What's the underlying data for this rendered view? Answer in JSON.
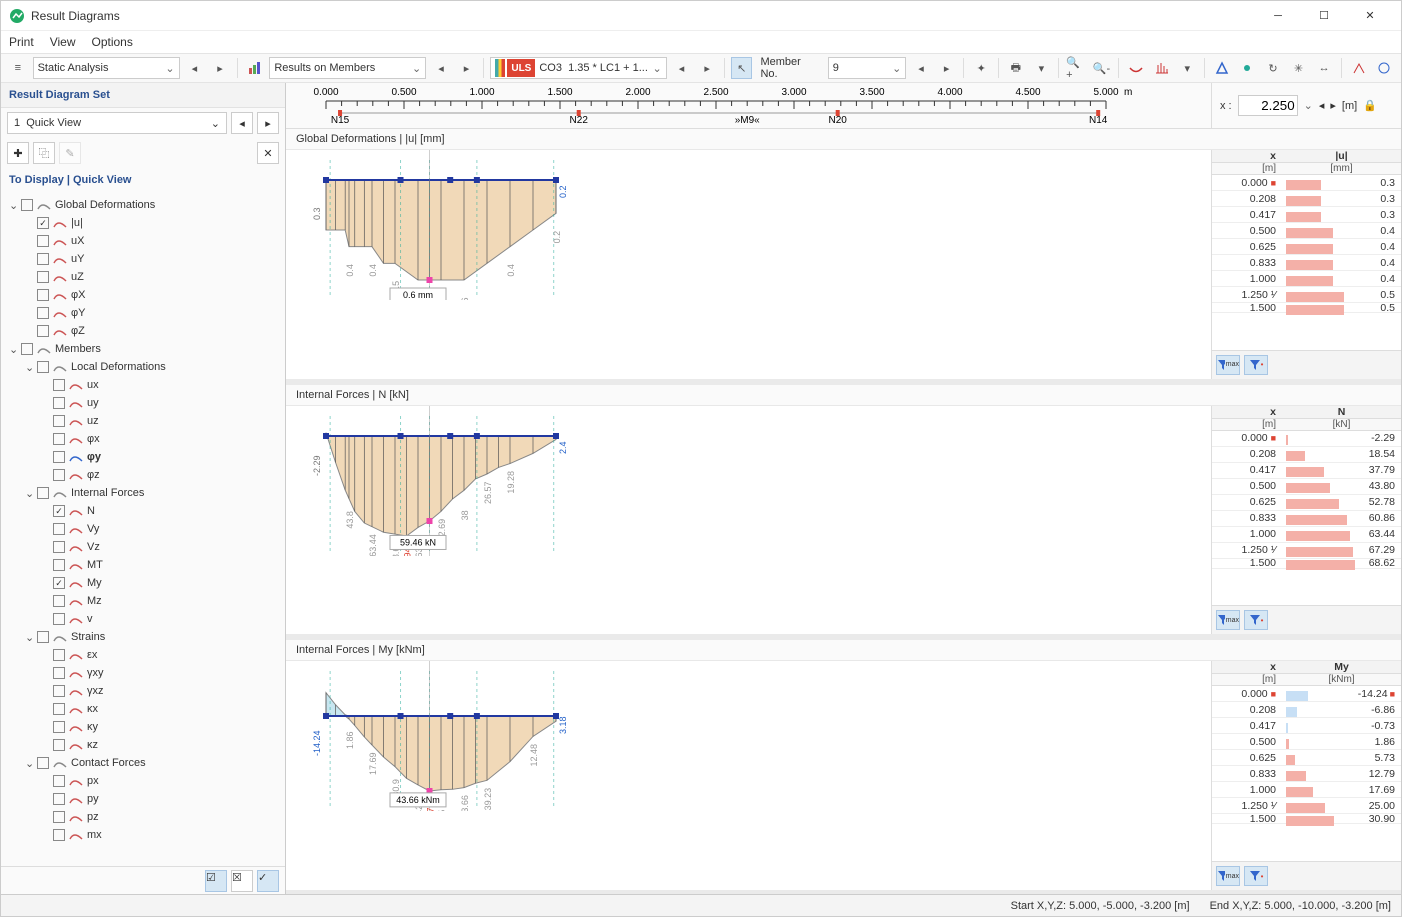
{
  "window": {
    "title": "Result Diagrams"
  },
  "menu": {
    "print": "Print",
    "view": "View",
    "options": "Options"
  },
  "toolbar": {
    "analysis_type": "Static Analysis",
    "results_target": "Results on Members",
    "uls_badge": "ULS",
    "load_combo_id": "CO3",
    "load_combo_expr": "1.35 * LC1 + 1...",
    "member_label": "Member No.",
    "member_no": "9"
  },
  "sidebar": {
    "panel_title": "Result Diagram Set",
    "set_no": "1",
    "set_name": "Quick View",
    "tree_title": "To Display | Quick View",
    "nodes": {
      "global_def": "Global Deformations",
      "u": "|u|",
      "ux": "uX",
      "uy": "uY",
      "uz": "uZ",
      "phix": "φX",
      "phiy": "φY",
      "phiz": "φZ",
      "members": "Members",
      "local_def": "Local Deformations",
      "lux": "ux",
      "luy": "uy",
      "luz": "uz",
      "lphix": "φx",
      "lphiy": "φy",
      "lphiz": "φz",
      "internal_forces": "Internal Forces",
      "n": "N",
      "vy": "Vy",
      "vz": "Vz",
      "mt": "MT",
      "my": "My",
      "mz": "Mz",
      "v": "v",
      "strains": "Strains",
      "ex": "εx",
      "gxy": "γxy",
      "gxz": "γxz",
      "kx": "κx",
      "ky": "κy",
      "kz": "κz",
      "contact": "Contact Forces",
      "px": "px",
      "py": "py",
      "pz": "pz",
      "mx": "mx"
    }
  },
  "ruler": {
    "ticks": [
      "0.000",
      "0.500",
      "1.000",
      "1.500",
      "2.000",
      "2.500",
      "3.000",
      "3.500",
      "4.000",
      "4.500",
      "5.000"
    ],
    "unit": "m",
    "nodes": {
      "n15": "N15",
      "n22": "N22",
      "m9": "»M9«",
      "n20": "N20",
      "n14": "N14"
    },
    "x_label": "x :",
    "x_value": "2.250",
    "x_unit": "[m]"
  },
  "charts": {
    "deform": {
      "title": "Global Deformations | |u| [mm]"
    },
    "n": {
      "title": "Internal Forces | N [kN]"
    },
    "my": {
      "title": "Internal Forces | My [kNm]"
    }
  },
  "chart_data": [
    {
      "id": "global_deformations_u",
      "title": "Global Deformations | |u| [mm]",
      "type": "area",
      "x_unit": "m",
      "y_unit": "mm",
      "x": [
        0.0,
        0.208,
        0.417,
        0.5,
        0.625,
        0.833,
        1.0,
        1.25,
        1.5,
        2.0,
        2.25,
        2.5,
        3.0,
        3.5,
        4.0,
        4.5,
        5.0
      ],
      "y": [
        0.3,
        0.3,
        0.3,
        0.4,
        0.4,
        0.4,
        0.4,
        0.5,
        0.5,
        0.6,
        0.6,
        0.6,
        0.6,
        0.5,
        0.4,
        0.3,
        0.2
      ],
      "max": 0.6,
      "max_x": 2.25,
      "label_at_cursor": "0.6 mm",
      "end_label_start": 0.3,
      "end_label_end": 0.2
    },
    {
      "id": "internal_forces_N",
      "title": "Internal Forces | N [kN]",
      "type": "area",
      "x_unit": "m",
      "y_unit": "kN",
      "x": [
        0.0,
        0.208,
        0.417,
        0.5,
        0.625,
        0.833,
        1.0,
        1.25,
        1.5,
        1.75,
        2.0,
        2.25,
        2.5,
        2.75,
        3.0,
        3.25,
        3.5,
        3.75,
        4.0,
        4.5,
        5.0
      ],
      "y": [
        -2.29,
        18.54,
        37.79,
        43.8,
        52.78,
        60.86,
        63.44,
        67.29,
        68.62,
        69.94,
        63.98,
        59.46,
        52.69,
        44.06,
        38.0,
        30.0,
        26.57,
        22.0,
        19.28,
        12.16,
        2.4
      ],
      "max": 69.94,
      "max_x": 1.75,
      "label_at_cursor": "59.46 kN",
      "end_label_start": -2.29,
      "end_label_end": 2.4
    },
    {
      "id": "internal_forces_My",
      "title": "Internal Forces | My [kNm]",
      "type": "area",
      "x_unit": "m",
      "y_unit": "kNm",
      "x": [
        0.0,
        0.208,
        0.417,
        0.5,
        0.625,
        0.833,
        1.0,
        1.25,
        1.5,
        1.75,
        2.0,
        2.25,
        2.5,
        2.75,
        3.0,
        3.25,
        3.5,
        4.0,
        4.5,
        5.0
      ],
      "y": [
        -14.24,
        -6.86,
        -0.73,
        1.86,
        5.73,
        12.79,
        17.69,
        25.0,
        30.9,
        38.0,
        42.0,
        45.73,
        45.0,
        44.7,
        43.66,
        41.0,
        39.23,
        27.82,
        12.48,
        3.18
      ],
      "max_pos": 45.73,
      "max_pos_x": 2.25,
      "max_neg": -14.24,
      "max_neg_x": 0.0,
      "label_at_cursor": "43.66 kNm",
      "end_label_start": -14.24,
      "end_label_end": 3.18
    }
  ],
  "tables": {
    "deform": {
      "head1": "x",
      "head2": "|u|",
      "unit1": "[m]",
      "unit2": "[mm]",
      "rows": [
        {
          "x": "0.000",
          "v": "0.3",
          "bar": 0.5,
          "mark": true
        },
        {
          "x": "0.208",
          "v": "0.3",
          "bar": 0.5
        },
        {
          "x": "0.417",
          "v": "0.3",
          "bar": 0.5
        },
        {
          "x": "0.500",
          "v": "0.4",
          "bar": 0.67
        },
        {
          "x": "0.625",
          "v": "0.4",
          "bar": 0.67
        },
        {
          "x": "0.833",
          "v": "0.4",
          "bar": 0.67
        },
        {
          "x": "1.000",
          "v": "0.4",
          "bar": 0.67
        },
        {
          "x": "1.250",
          "v": "0.5",
          "bar": 0.83,
          "trunc": true
        },
        {
          "x": "1.500",
          "v": "0.5",
          "bar": 0.83,
          "clip": true
        }
      ]
    },
    "n": {
      "head1": "x",
      "head2": "N",
      "unit1": "[m]",
      "unit2": "[kN]",
      "rows": [
        {
          "x": "0.000",
          "v": "-2.29",
          "bar": 0.03,
          "mark": true
        },
        {
          "x": "0.208",
          "v": "18.54",
          "bar": 0.27
        },
        {
          "x": "0.417",
          "v": "37.79",
          "bar": 0.54
        },
        {
          "x": "0.500",
          "v": "43.80",
          "bar": 0.63
        },
        {
          "x": "0.625",
          "v": "52.78",
          "bar": 0.75
        },
        {
          "x": "0.833",
          "v": "60.86",
          "bar": 0.87
        },
        {
          "x": "1.000",
          "v": "63.44",
          "bar": 0.91
        },
        {
          "x": "1.250",
          "v": "67.29",
          "bar": 0.96,
          "trunc": true
        },
        {
          "x": "1.500",
          "v": "68.62",
          "bar": 0.98,
          "clip": true
        }
      ]
    },
    "my": {
      "head1": "x",
      "head2": "My",
      "unit1": "[m]",
      "unit2": "[kNm]",
      "rows": [
        {
          "x": "0.000",
          "v": "-14.24",
          "bar": 0.31,
          "mark": true,
          "neg": true,
          "maxmark": true
        },
        {
          "x": "0.208",
          "v": "-6.86",
          "bar": 0.15,
          "neg": true
        },
        {
          "x": "0.417",
          "v": "-0.73",
          "bar": 0.02,
          "neg": true
        },
        {
          "x": "0.500",
          "v": "1.86",
          "bar": 0.04
        },
        {
          "x": "0.625",
          "v": "5.73",
          "bar": 0.13
        },
        {
          "x": "0.833",
          "v": "12.79",
          "bar": 0.28
        },
        {
          "x": "1.000",
          "v": "17.69",
          "bar": 0.39
        },
        {
          "x": "1.250",
          "v": "25.00",
          "bar": 0.55,
          "trunc": true
        },
        {
          "x": "1.500",
          "v": "30.90",
          "bar": 0.68,
          "clip": true
        }
      ]
    }
  },
  "status": {
    "start": "Start X,Y,Z: 5.000, -5.000, -3.200 [m]",
    "end": "End X,Y,Z: 5.000, -10.000, -3.200 [m]"
  },
  "funnel_labels": {
    "max": "max"
  }
}
